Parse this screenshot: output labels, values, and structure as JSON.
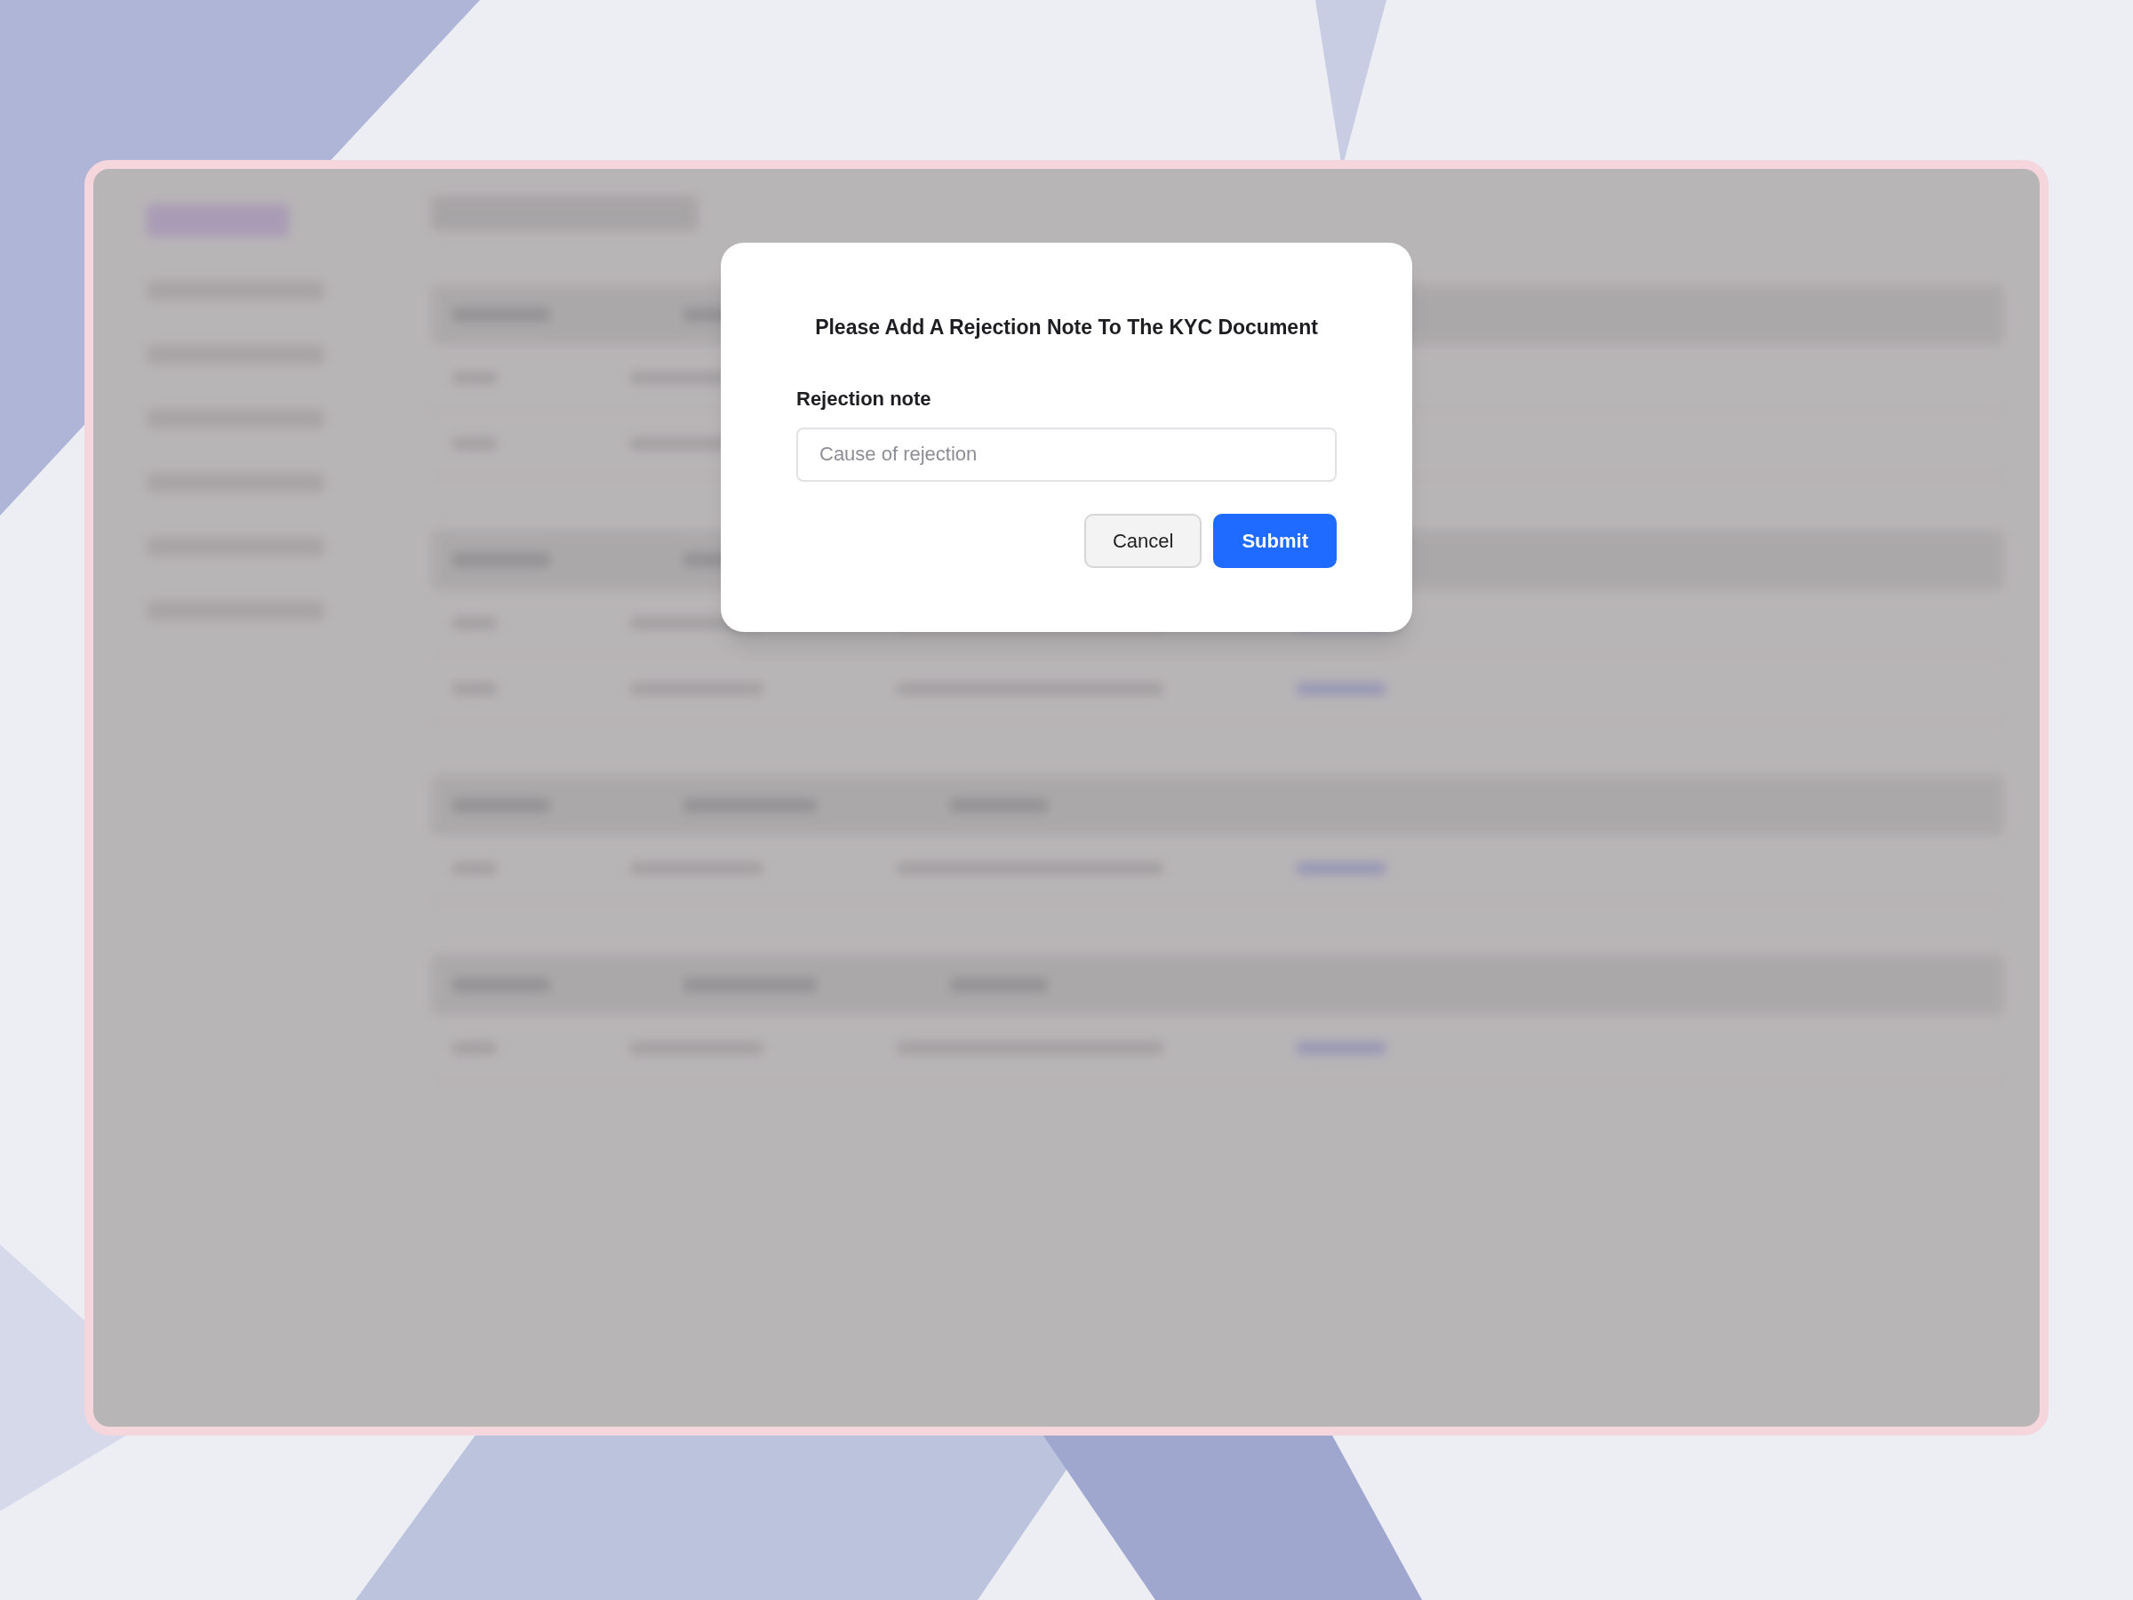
{
  "dialog": {
    "title": "Please Add A Rejection Note To The KYC Document",
    "field": {
      "label": "Rejection note",
      "placeholder": "Cause of rejection"
    },
    "buttons": [
      {
        "label": "Cancel",
        "kind": "secondary"
      },
      {
        "label": "Submit",
        "kind": "primary"
      }
    ]
  }
}
